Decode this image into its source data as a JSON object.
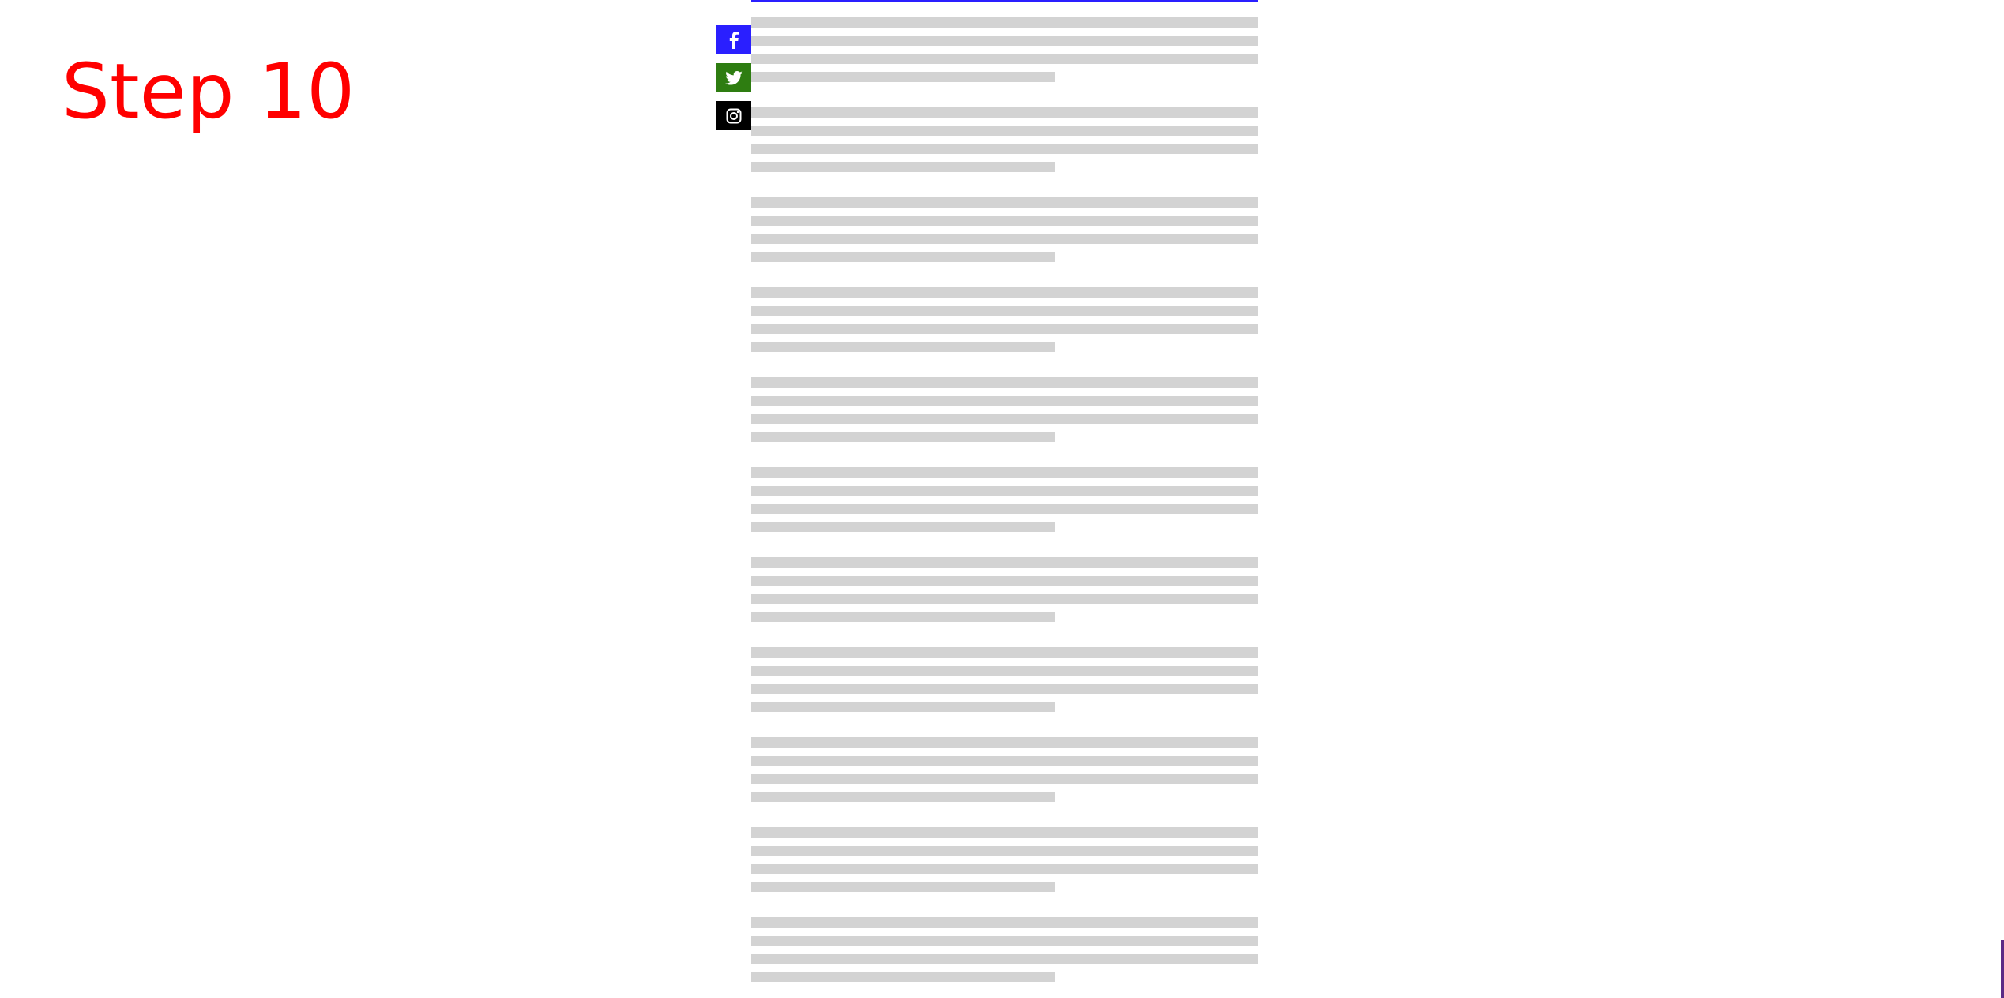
{
  "title": "Step 10",
  "colors": {
    "title": "#ff0000",
    "accent_line": "#2a1fff",
    "placeholder_line": "#d3d3d3",
    "corner_mark": "#5b2a86"
  },
  "social": [
    {
      "name": "facebook",
      "icon": "facebook-icon",
      "color": "#2a1fff"
    },
    {
      "name": "twitter",
      "icon": "twitter-icon",
      "color": "#2e7d11"
    },
    {
      "name": "instagram",
      "icon": "instagram-icon",
      "color": "#000000"
    }
  ],
  "content": {
    "paragraph_count": 11,
    "lines_per_paragraph": 4
  }
}
